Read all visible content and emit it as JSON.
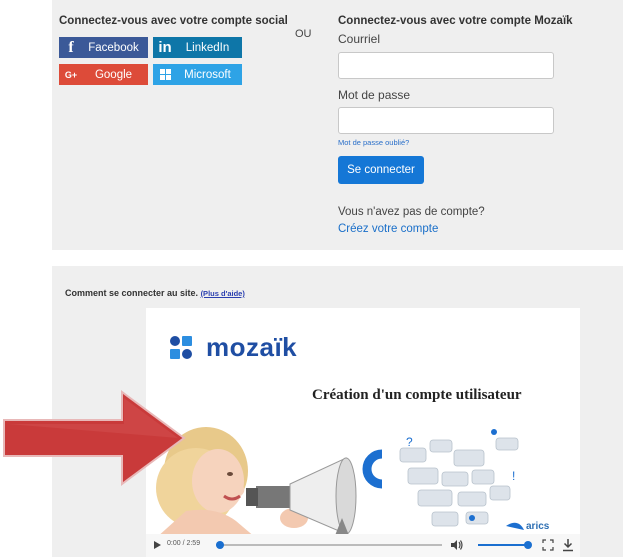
{
  "login": {
    "social_heading": "Connectez-vous avec votre compte social",
    "social_buttons": {
      "facebook": {
        "icon": "f",
        "label": "Facebook"
      },
      "linkedin": {
        "icon": "in",
        "label": "LinkedIn"
      },
      "google": {
        "icon": "G+",
        "label": "Google"
      },
      "microsoft": {
        "label": "Microsoft"
      }
    },
    "or_text": "OU",
    "mozaik_heading": "Connectez-vous avec votre compte Mozaïk",
    "email_label": "Courriel",
    "email_value": "",
    "password_label": "Mot de passe",
    "password_value": "",
    "forgot_password": "Mot de passe oublié?",
    "connect_button": "Se connecter",
    "no_account": "Vous n'avez pas de compte?",
    "create_account": "Créez votre compte"
  },
  "help": {
    "heading": "Comment se connecter au site.",
    "help_link": "(Plus d'aide)",
    "video": {
      "logo_text": "mozaïk",
      "title": "Création d'un compte utilisateur",
      "brand": "arics",
      "time": "0:00 / 2:59",
      "progress": 0.0,
      "volume": 1.0
    }
  },
  "colors": {
    "facebook": "#3b5998",
    "linkedin": "#0e76a8",
    "google": "#dd4b39",
    "microsoft": "#2ea3e6",
    "primary": "#1577d6",
    "arrow": "#c0392b"
  }
}
